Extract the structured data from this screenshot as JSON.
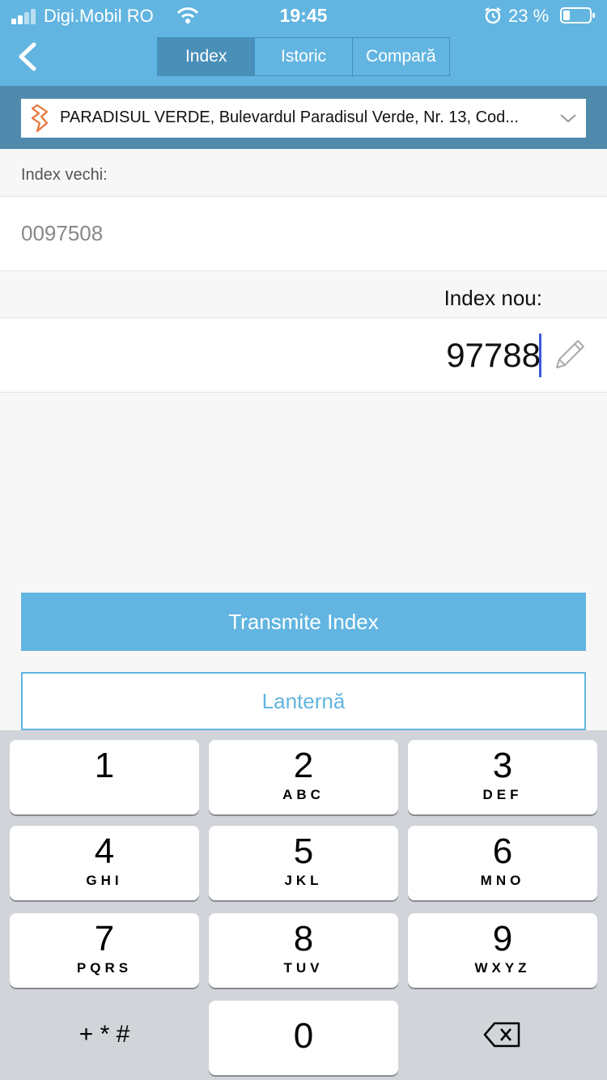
{
  "status": {
    "carrier": "Digi.Mobil RO",
    "time": "19:45",
    "battery_percent": "23 %"
  },
  "nav": {
    "tabs": [
      {
        "label": "Index",
        "active": true
      },
      {
        "label": "Istoric",
        "active": false
      },
      {
        "label": "Compară",
        "active": false
      }
    ]
  },
  "location": {
    "text": "PARADISUL VERDE, Bulevardul Paradisul Verde, Nr. 13, Cod...",
    "icon": "electricity-icon"
  },
  "form": {
    "old_label": "Index vechi:",
    "old_value": "0097508",
    "new_label": "Index nou:",
    "new_value": "97788"
  },
  "actions": {
    "submit_label": "Transmite Index",
    "flashlight_label": "Lanternă"
  },
  "keypad": {
    "keys": [
      {
        "num": "1",
        "letters": ""
      },
      {
        "num": "2",
        "letters": "ABC"
      },
      {
        "num": "3",
        "letters": "DEF"
      },
      {
        "num": "4",
        "letters": "GHI"
      },
      {
        "num": "5",
        "letters": "JKL"
      },
      {
        "num": "6",
        "letters": "MNO"
      },
      {
        "num": "7",
        "letters": "PQRS"
      },
      {
        "num": "8",
        "letters": "TUV"
      },
      {
        "num": "9",
        "letters": "WXYZ"
      },
      {
        "num": "0",
        "letters": ""
      }
    ],
    "symbols": "+ * #"
  },
  "colors": {
    "header": "#62b5e0",
    "location_bar": "#4f8aad",
    "accent": "#62b5e0",
    "icon_orange": "#e8743b"
  }
}
